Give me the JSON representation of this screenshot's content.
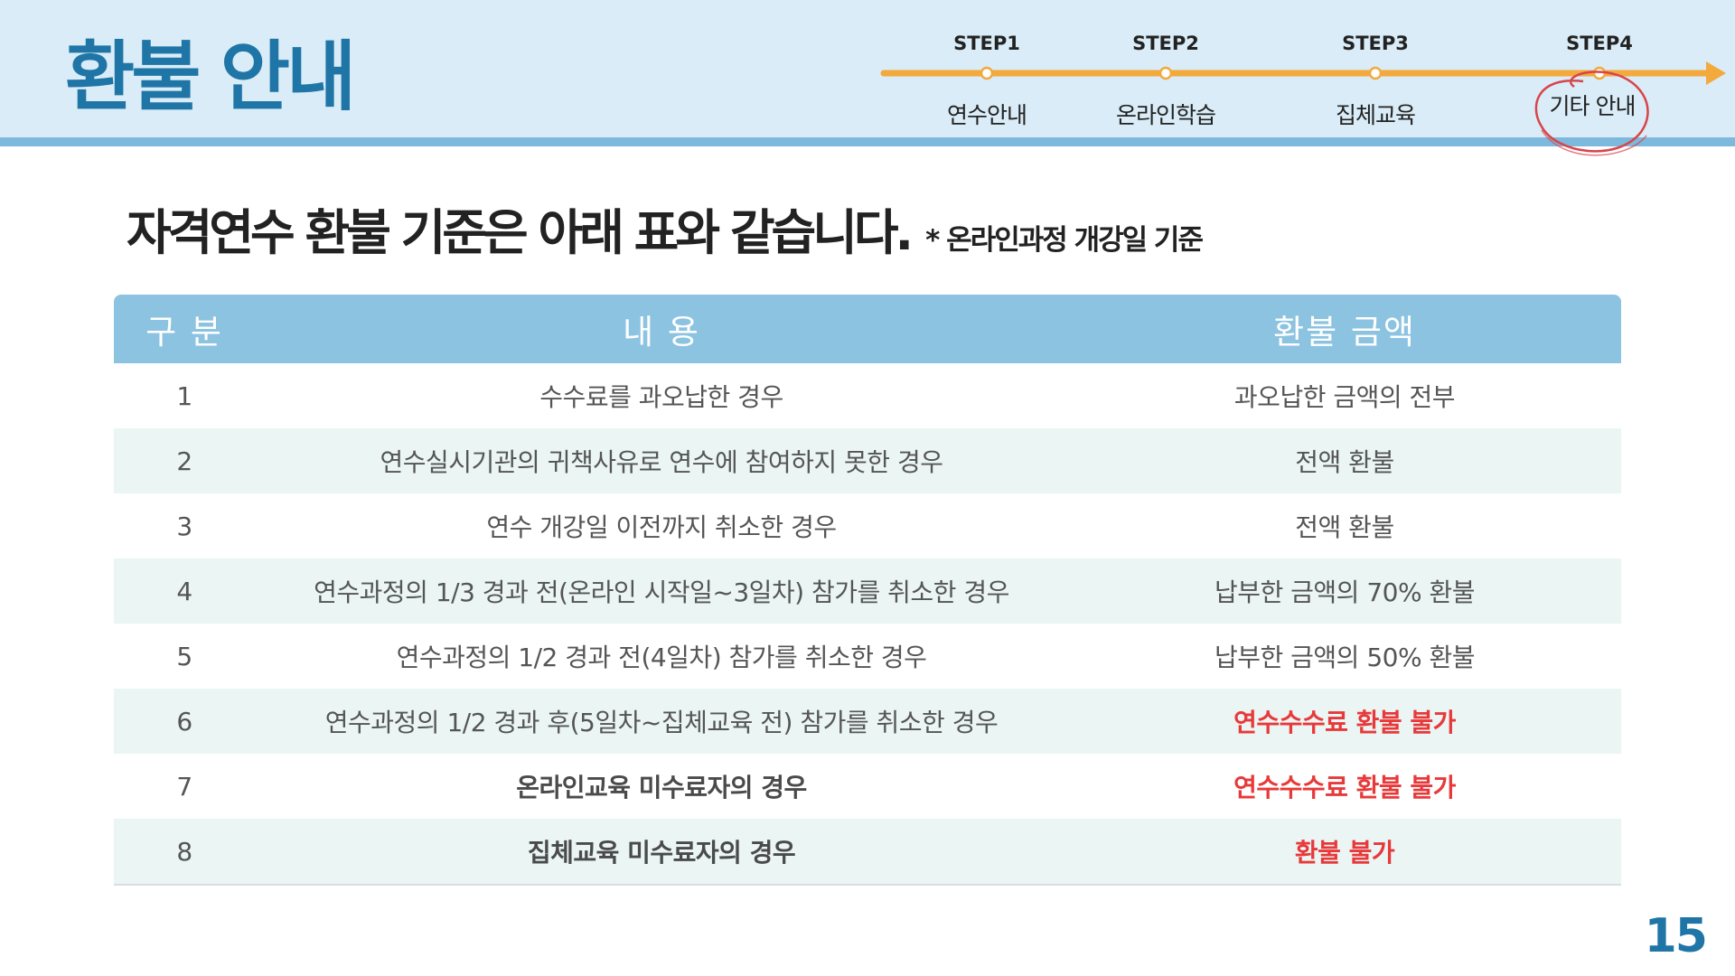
{
  "page_title": "환불 안내",
  "steps": [
    {
      "step": "STEP1",
      "name": "연수안내"
    },
    {
      "step": "STEP2",
      "name": "온라인학습"
    },
    {
      "step": "STEP3",
      "name": "집체교육"
    },
    {
      "step": "STEP4",
      "name": "기타 안내"
    }
  ],
  "current_step": "STEP4",
  "colors": {
    "accent": "#1f76a6",
    "progress_line": "#f3a93b",
    "highlight_circle": "#d9444a",
    "table_header": "#8cc3e1",
    "alt_row": "#eaf5f4",
    "warning_text": "#e8393a"
  },
  "headline": {
    "main": "자격연수 환불 기준은 아래 표와 같습니다.",
    "note": "* 온라인과정 개강일 기준"
  },
  "table": {
    "headers": [
      "구 분",
      "내 용",
      "환불 금액"
    ],
    "rows": [
      {
        "no": "1",
        "content": "수수료를 과오납한 경우",
        "refund": "과오납한 금액의 전부"
      },
      {
        "no": "2",
        "content": "연수실시기관의 귀책사유로 연수에 참여하지 못한 경우",
        "refund": "전액 환불"
      },
      {
        "no": "3",
        "content": "연수 개강일 이전까지 취소한 경우",
        "refund": "전액 환불"
      },
      {
        "no": "4",
        "content": "연수과정의 1/3 경과 전(온라인 시작일~3일차) 참가를 취소한 경우",
        "refund": "납부한 금액의 70% 환불"
      },
      {
        "no": "5",
        "content": "연수과정의 1/2 경과 전(4일차) 참가를 취소한 경우",
        "refund": "납부한 금액의 50% 환불"
      },
      {
        "no": "6",
        "content": "연수과정의 1/2 경과 후(5일차~집체교육 전) 참가를 취소한 경우",
        "refund": "연수수수료 환불 불가"
      },
      {
        "no": "7",
        "content": "온라인교육 미수료자의 경우",
        "refund": "연수수수료 환불 불가"
      },
      {
        "no": "8",
        "content": "집체교육 미수료자의 경우",
        "refund": "환불 불가"
      }
    ]
  },
  "page_number": "15"
}
